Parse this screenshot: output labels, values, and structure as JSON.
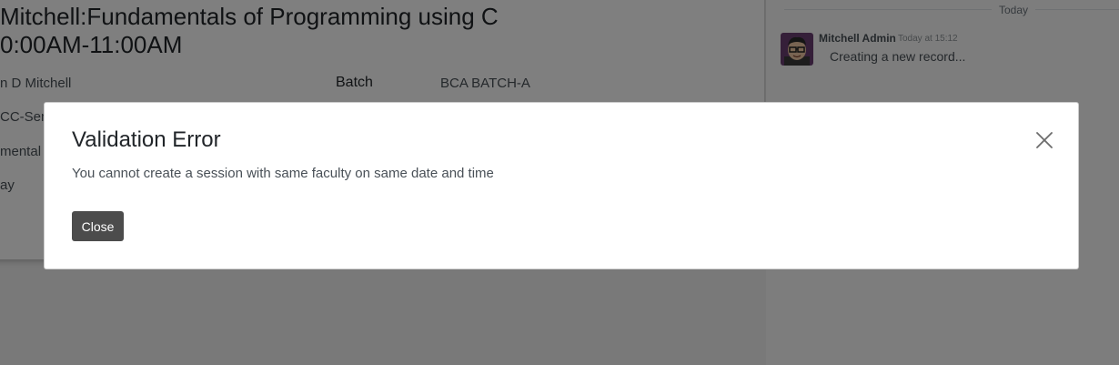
{
  "background": {
    "record_title_line1": "Mitchell:Fundamentals of Programming using C",
    "record_title_line2": "0:00AM-11:00AM",
    "faculty_value": "n D Mitchell",
    "batch_label": "Batch",
    "batch_value": "BCA BATCH-A",
    "course_value": "CC-Sem",
    "subject_value": "mental",
    "day_value": "ay"
  },
  "chatter": {
    "date_separator": "Today",
    "messages": [
      {
        "author": "Mitchell Admin",
        "date": "Today at 15:12",
        "body": "Creating a new record..."
      }
    ]
  },
  "dialog": {
    "title": "Validation Error",
    "message": "You cannot create a session with same faculty on same date and time",
    "close_button_label": "Close",
    "close_icon": "close-icon"
  },
  "colors": {
    "backdrop": "#000000",
    "close_button": "#4c4c4c"
  }
}
